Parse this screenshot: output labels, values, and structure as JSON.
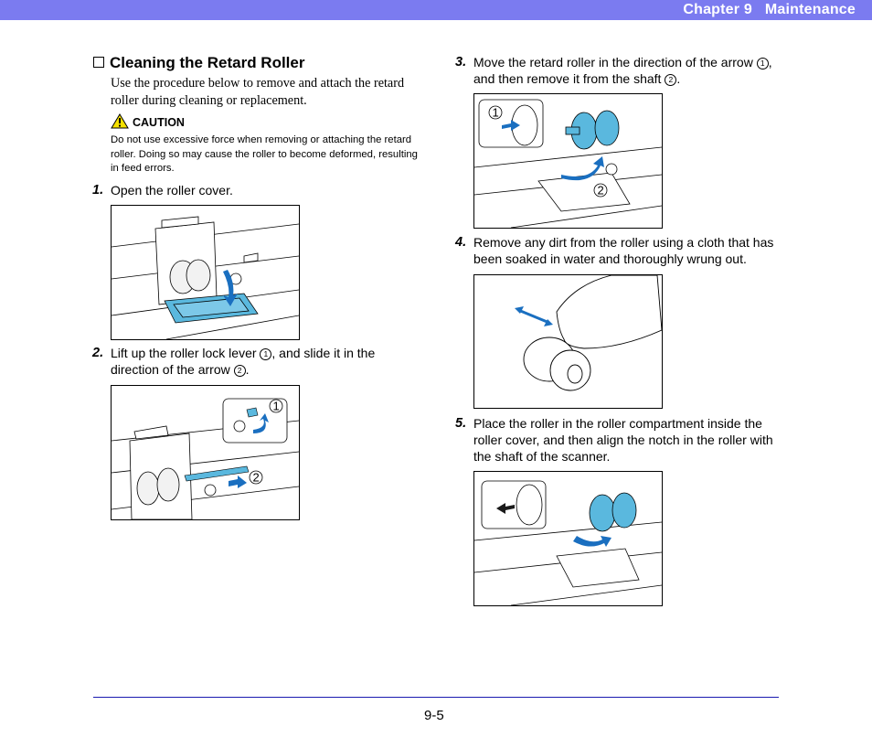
{
  "header": {
    "chapter": "Chapter 9   Maintenance"
  },
  "section": {
    "title": "Cleaning the Retard Roller",
    "intro": "Use the procedure below to remove and attach the retard roller during cleaning or replacement."
  },
  "caution": {
    "label": "CAUTION",
    "text": "Do not use excessive force when removing or attaching the retard roller. Doing so may cause the roller to become deformed, resulting in feed errors."
  },
  "steps": [
    {
      "num": "1.",
      "text": "Open the roller cover."
    },
    {
      "num": "2.",
      "text_a": "Lift up the roller lock lever ",
      "m1": "1",
      "text_b": ", and slide it in the direction of the arrow ",
      "m2": "2",
      "text_c": "."
    },
    {
      "num": "3.",
      "text_a": "Move the retard roller in the direction of the arrow ",
      "m1": "1",
      "text_b": ", and then remove it from the shaft ",
      "m2": "2",
      "text_c": "."
    },
    {
      "num": "4.",
      "text": "Remove any dirt from the roller using a cloth that has been soaked in water and thoroughly wrung out."
    },
    {
      "num": "5.",
      "text": "Place the roller in the roller compartment inside the roller cover, and then align the notch in the roller with the shaft of the scanner."
    }
  ],
  "figures": {
    "callout_1": "1",
    "callout_2": "2"
  },
  "colors": {
    "header_bg": "#7b7bf0",
    "accent_blue": "#4fb3e0",
    "arrow_blue": "#1a6fc0"
  },
  "footer": {
    "page": "9-5"
  }
}
